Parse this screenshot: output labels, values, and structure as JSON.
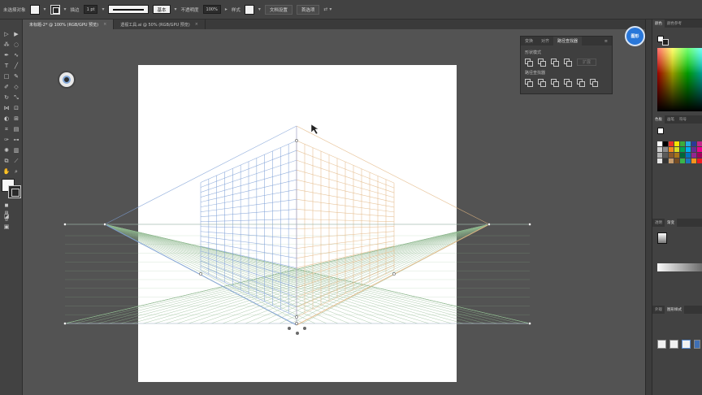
{
  "control_bar": {
    "selection_label": "未选择对象",
    "stroke_label": "描边",
    "stroke_weight": "1 pt",
    "stroke_style": "基本",
    "opacity_label": "不透明度",
    "opacity_value": "100%",
    "style_label": "样式",
    "document_setup_button": "文档设置",
    "preferences_button": "首选项"
  },
  "tabs": [
    {
      "label": "未标题-2* @ 100% (RGB/GPU 预览)",
      "close": "×",
      "active": true
    },
    {
      "label": "透视工具.ai @ 50% (RGB/GPU 预览)",
      "close": "×",
      "active": false
    }
  ],
  "pathfinder_panel": {
    "tabs": [
      "变换",
      "对齐",
      "路径查找器"
    ],
    "active_tab": "路径查找器",
    "shape_modes_label": "形状模式",
    "pathfinders_label": "路径查找器",
    "expand_button": "扩展"
  },
  "right_dock": {
    "color_tabs": [
      "颜色",
      "颜色参考"
    ],
    "swatch_tabs": [
      "色板",
      "画笔",
      "符号"
    ],
    "gradient_tabs": [
      "透明",
      "渐变"
    ],
    "graphic_style_tabs": [
      "外观",
      "图形样式"
    ]
  },
  "logo_text": "图形",
  "colors": {
    "blue_grid": "#7d9fd6",
    "orange_grid": "#e2b682",
    "green_grid": "#8fb88f",
    "logo_blue": "#2977d9"
  }
}
